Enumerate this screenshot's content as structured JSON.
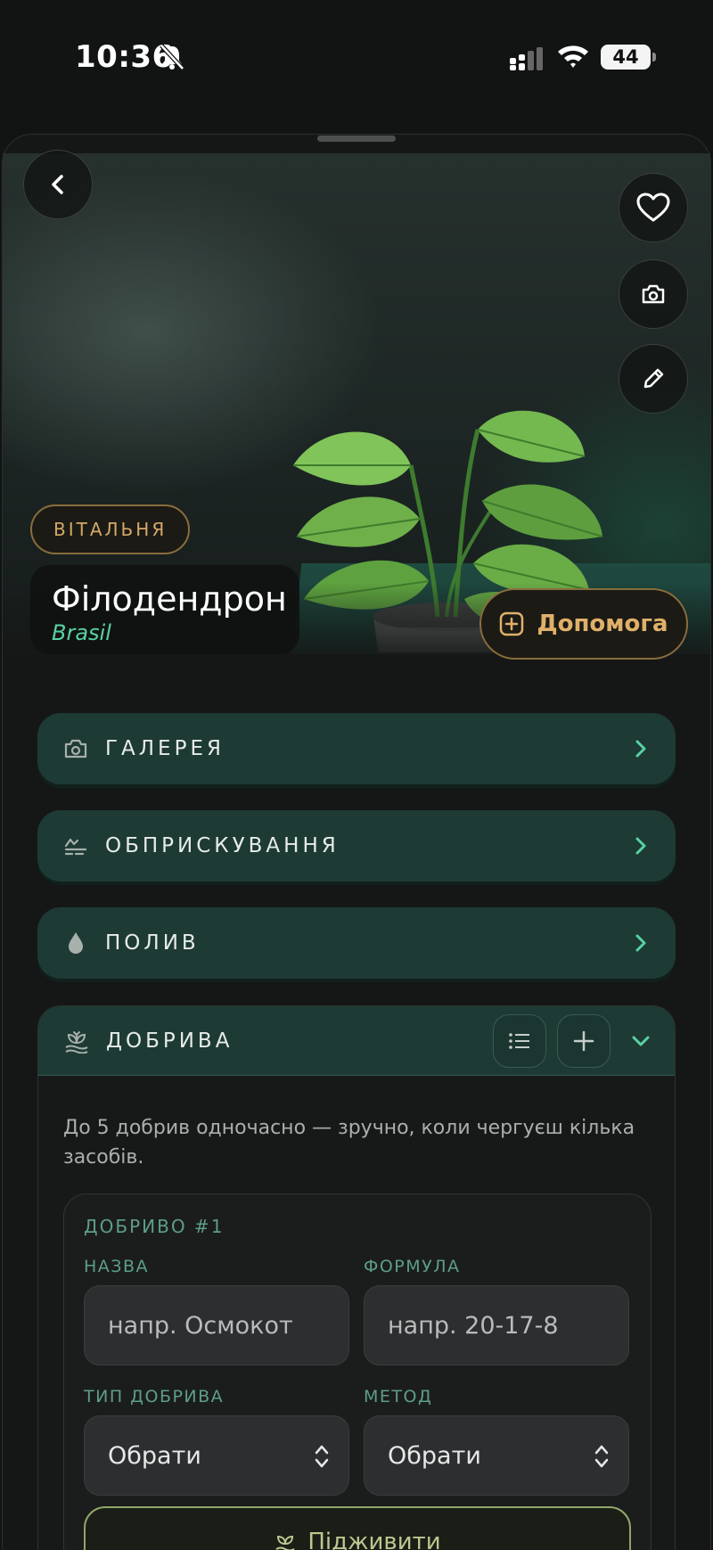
{
  "status_bar": {
    "time": "10:36",
    "battery": "44"
  },
  "hero": {
    "room_badge": "ВІТАЛЬНЯ",
    "plant_name": "Філодендрон",
    "plant_variety": "Brasil",
    "help_label": "Допомога"
  },
  "sections": [
    {
      "label": "ГАЛЕРЕЯ",
      "icon": "camera-icon"
    },
    {
      "label": "ОБПРИСКУВАННЯ",
      "icon": "mist-icon"
    },
    {
      "label": "ПОЛИВ",
      "icon": "droplet-icon"
    }
  ],
  "fertilizer": {
    "label": "ДОБРИВА",
    "hint": "До 5 добрив одночасно — зручно, коли чергуєш кілька засобів.",
    "card_title": "ДОБРИВО #1",
    "name_label": "НАЗВА",
    "name_placeholder": "напр. Осмокот",
    "formula_label": "ФОРМУЛА",
    "formula_placeholder": "напр. 20-17-8",
    "type_label": "ТИП ДОБРИВА",
    "type_value": "Обрати",
    "method_label": "МЕТОД",
    "method_value": "Обрати",
    "feed_button": "Підживити"
  },
  "colors": {
    "background": "#151716",
    "section_bg": "#1e3a34",
    "accent_green": "#58d2a3",
    "accent_gold": "#d4a867"
  }
}
